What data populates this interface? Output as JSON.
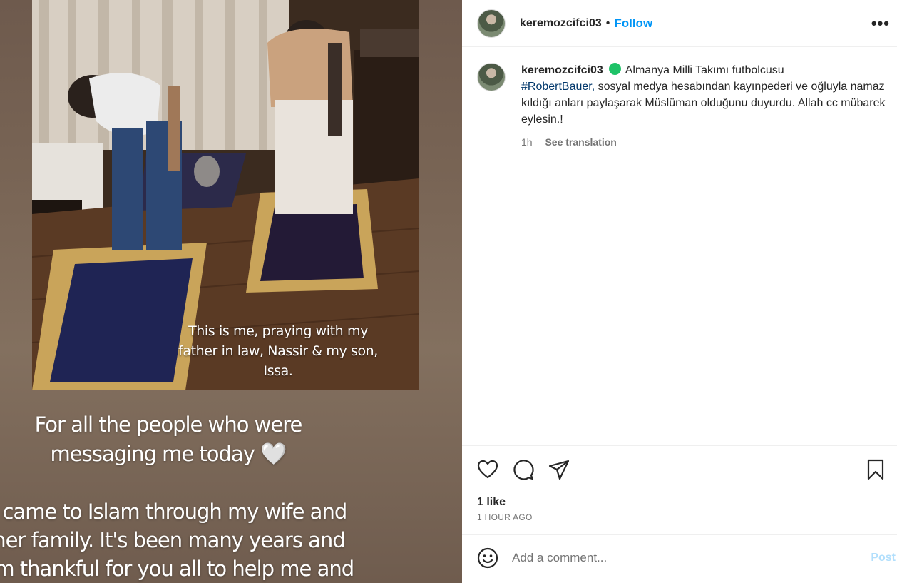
{
  "post": {
    "username": "keremozcifci03",
    "dot": "•",
    "follow_label": "Follow",
    "more_label": "•••"
  },
  "caption": {
    "username": "keremozcifci03",
    "text_1": "Almanya Milli Takımı futbolcusu",
    "hashtag": "#RobertBauer,",
    "text_2": " sosyal medya hesabından kayınpederi ve oğluyla namaz kıldığı anları paylaşarak Müslüman olduğunu duyurdu. Allah cc mübarek eylesin.!",
    "age": "1h",
    "see_translation": "See translation"
  },
  "media": {
    "photo_caption": "This is me, praying with my father in law, Nassir & my son, Issa.",
    "story_line_1": "For all the people who were",
    "story_line_2": "messaging me today",
    "story_line_3": "I came to Islam through my wife and",
    "story_line_4": "her family. It's been many years and",
    "story_line_5": "I'm thankful for you all to help me and"
  },
  "engagement": {
    "likes": "1 like",
    "timestamp": "1 HOUR AGO"
  },
  "comment": {
    "placeholder": "Add a comment...",
    "post_label": "Post"
  },
  "colors": {
    "link_blue": "#0095f6",
    "hashtag_blue": "#00376b",
    "verified_green": "#1ec267",
    "muted_text": "#737373"
  },
  "icons": [
    "heart-icon",
    "comment-icon",
    "share-icon",
    "bookmark-icon",
    "emoji-icon",
    "more-icon"
  ]
}
